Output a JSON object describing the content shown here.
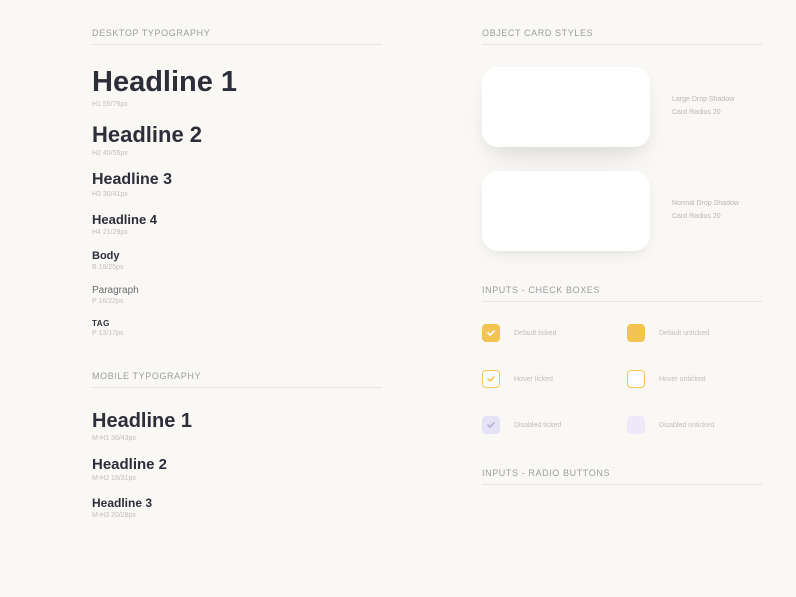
{
  "left": {
    "desktop": {
      "title": "DESKTOP TYPOGRAPHY",
      "items": [
        {
          "label": "Headline 1",
          "spec": "H1 55/75px"
        },
        {
          "label": "Headline 2",
          "spec": "H2 40/55px"
        },
        {
          "label": "Headline 3",
          "spec": "H3 30/41px"
        },
        {
          "label": "Headline 4",
          "spec": "H4 21/29px"
        },
        {
          "label": "Body",
          "spec": "B 18/25px"
        },
        {
          "label": "Paragraph",
          "spec": "P 16/22px"
        },
        {
          "label": "TAG",
          "spec": "P 13/17px"
        }
      ]
    },
    "mobile": {
      "title": "MOBILE TYPOGRAPHY",
      "items": [
        {
          "label": "Headline 1",
          "spec": "M-H1 36/43px"
        },
        {
          "label": "Headline 2",
          "spec": "M-H2 18/31px"
        },
        {
          "label": "Headline 3",
          "spec": "M-H3 20/28px"
        }
      ]
    }
  },
  "right": {
    "cards": {
      "title": "OBJECT CARD STYLES",
      "items": [
        {
          "l1": "Large Drop Shadow",
          "l2": "Card Radius 20"
        },
        {
          "l1": "Normal Drop Shadow",
          "l2": "Card Radius 20"
        }
      ]
    },
    "checkboxes": {
      "title": "INPUTS - CHECK BOXES",
      "items": [
        {
          "label": "Default ticked"
        },
        {
          "label": "Default unticked"
        },
        {
          "label": "Hover ticked"
        },
        {
          "label": "Hover unticked"
        },
        {
          "label": "Disabled ticked"
        },
        {
          "label": "Disabled unticked"
        }
      ]
    },
    "radios": {
      "title": "INPUTS - RADIO BUTTONS"
    }
  }
}
